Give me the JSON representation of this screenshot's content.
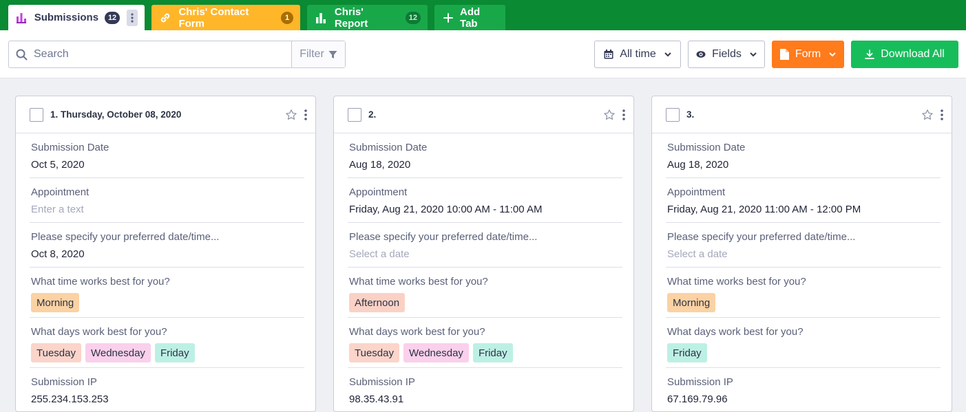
{
  "tabs": [
    {
      "label": "Submissions",
      "badge": "12",
      "icon": "bar-chart-icon"
    },
    {
      "label": "Chris' Contact Form",
      "badge": "1",
      "icon": "link-icon"
    },
    {
      "label": "Chris' Report",
      "badge": "12",
      "icon": "bar-chart-icon"
    },
    {
      "label": "Add Tab",
      "icon": "plus-icon"
    }
  ],
  "toolbar": {
    "search_placeholder": "Search",
    "filter_label": "Filter",
    "alltime_label": "All time",
    "fields_label": "Fields",
    "form_label": "Form",
    "download_label": "Download All"
  },
  "colors": {
    "tabbar": "#0a8a32",
    "contact_tab": "#ffb629",
    "report_tab": "#18a84a",
    "form_button": "#ff7b1c",
    "download_button": "#18bd5b"
  },
  "cards": [
    {
      "title": "1. Thursday, October 08, 2020",
      "submission_date_label": "Submission Date",
      "submission_date": "Oct 5, 2020",
      "appointment_label": "Appointment",
      "appointment": "Enter a text",
      "preferred_label": "Please specify your preferred date/time...",
      "preferred": "Oct 8, 2020",
      "time_label": "What time works best for you?",
      "time": "Morning",
      "days_label": "What days work best for you?",
      "days": [
        "Tuesday",
        "Wednesday",
        "Friday"
      ],
      "ip_label": "Submission IP",
      "ip": "255.234.153.253"
    },
    {
      "title": "2.",
      "submission_date_label": "Submission Date",
      "submission_date": "Aug 18, 2020",
      "appointment_label": "Appointment",
      "appointment": "Friday, Aug 21, 2020 10:00 AM - 11:00 AM",
      "preferred_label": "Please specify your preferred date/time...",
      "preferred": "Select a date",
      "time_label": "What time works best for you?",
      "time": "Afternoon",
      "days_label": "What days work best for you?",
      "days": [
        "Tuesday",
        "Wednesday",
        "Friday"
      ],
      "ip_label": "Submission IP",
      "ip": "98.35.43.91"
    },
    {
      "title": "3.",
      "submission_date_label": "Submission Date",
      "submission_date": "Aug 18, 2020",
      "appointment_label": "Appointment",
      "appointment": "Friday, Aug 21, 2020 11:00 AM - 12:00 PM",
      "preferred_label": "Please specify your preferred date/time...",
      "preferred": "Select a date",
      "time_label": "What time works best for you?",
      "time": "Morning",
      "days_label": "What days work best for you?",
      "days": [
        "Friday"
      ],
      "ip_label": "Submission IP",
      "ip": "67.169.79.96"
    }
  ]
}
